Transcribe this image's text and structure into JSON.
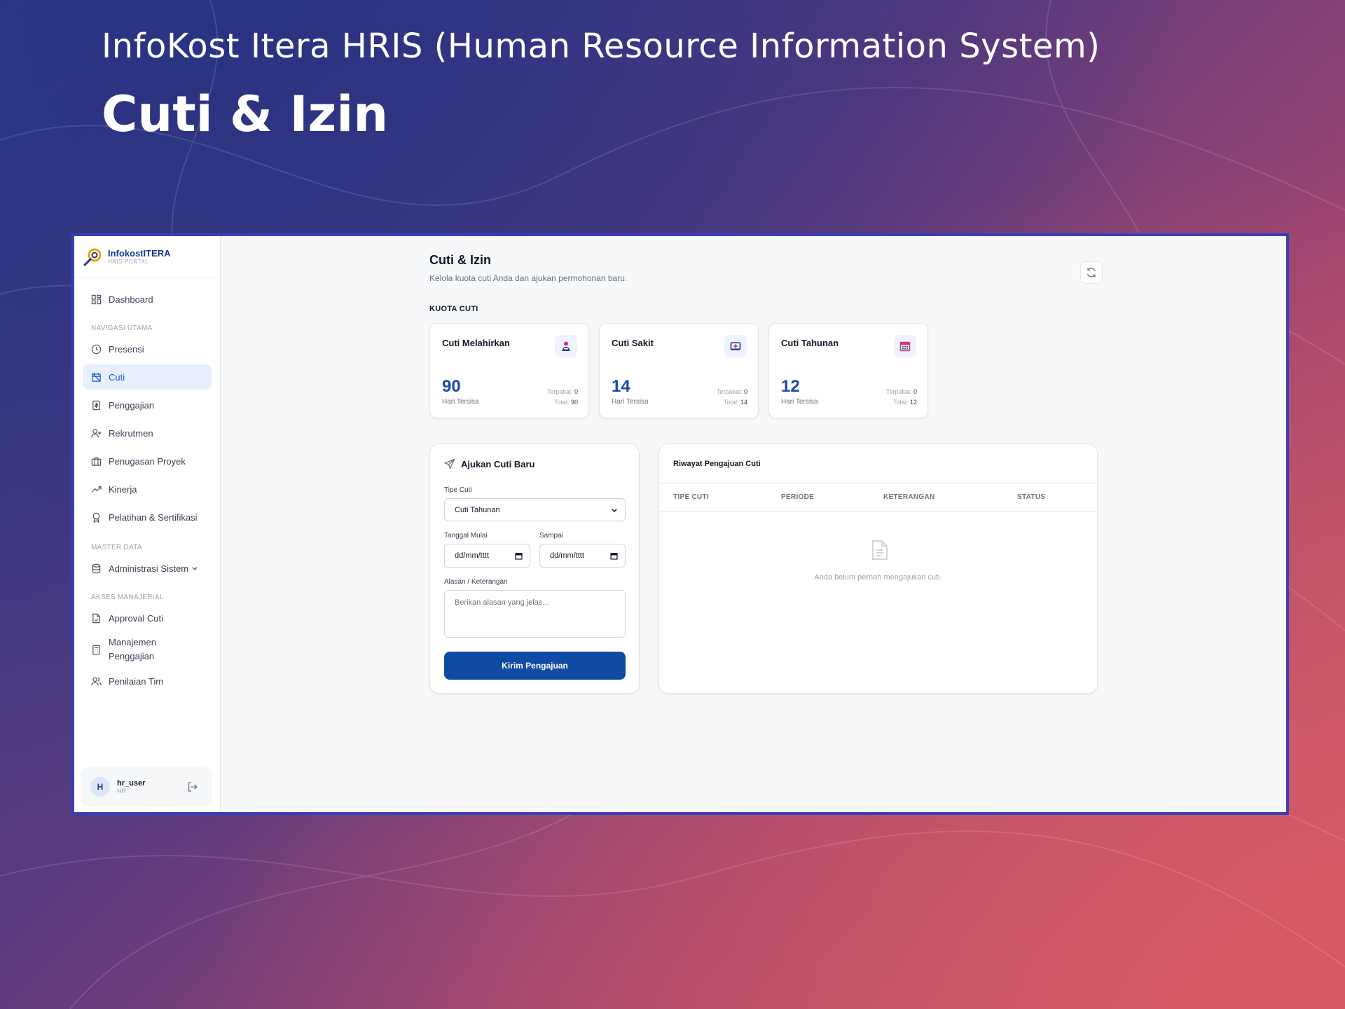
{
  "slide": {
    "subtitle": "InfoKost Itera HRIS (Human Resource Information System)",
    "title": "Cuti & Izin"
  },
  "brand": {
    "name": "InfokostITERA",
    "sub": "HRIS PORTAL"
  },
  "sidebar": {
    "dashboard": "Dashboard",
    "section_main": "NAVIGASI UTAMA",
    "main_items": [
      {
        "label": "Presensi",
        "icon": "clock-icon"
      },
      {
        "label": "Cuti",
        "icon": "calendar-off-icon",
        "active": true
      },
      {
        "label": "Penggajian",
        "icon": "receipt-icon"
      },
      {
        "label": "Rekrutmen",
        "icon": "user-plus-icon"
      },
      {
        "label": "Penugasan Proyek",
        "icon": "briefcase-icon"
      },
      {
        "label": "Kinerja",
        "icon": "trending-up-icon"
      },
      {
        "label": "Pelatihan & Sertifikasi",
        "icon": "award-icon"
      }
    ],
    "section_master": "MASTER DATA",
    "master_items": [
      {
        "label": "Administrasi Sistem",
        "icon": "database-icon"
      }
    ],
    "section_managerial": "AKSES MANAJERIAL",
    "managerial_items": [
      {
        "label": "Approval Cuti",
        "icon": "file-check-icon"
      },
      {
        "label": "Manajemen Penggajian",
        "icon": "calculator-icon"
      },
      {
        "label": "Penilaian Tim",
        "icon": "users-icon"
      }
    ],
    "user": {
      "initial": "H",
      "name": "hr_user",
      "role": "HR"
    }
  },
  "page": {
    "title": "Cuti & Izin",
    "description": "Kelola kuota cuti Anda dan ajukan permohonan baru.",
    "quota_label": "KUOTA CUTI"
  },
  "quota_cards": [
    {
      "title": "Cuti Melahirkan",
      "remaining": "90",
      "remaining_label": "Hari Tersisa",
      "used_label": "Terpakai:",
      "used": "0",
      "total_label": "Total:",
      "total": "90",
      "icon": "maternity-icon",
      "icon_color": "#d6336c"
    },
    {
      "title": "Cuti Sakit",
      "remaining": "14",
      "remaining_label": "Hari Tersisa",
      "used_label": "Terpakai:",
      "used": "0",
      "total_label": "Total:",
      "total": "14",
      "icon": "medical-icon",
      "icon_color": "#1e3a8a"
    },
    {
      "title": "Cuti Tahunan",
      "remaining": "12",
      "remaining_label": "Hari Tersisa",
      "used_label": "Terpakai:",
      "used": "0",
      "total_label": "Total:",
      "total": "12",
      "icon": "calendar-icon",
      "icon_color": "#d6336c"
    }
  ],
  "form": {
    "title": "Ajukan Cuti Baru",
    "type_label": "Tipe Cuti",
    "type_value": "Cuti Tahunan",
    "start_label": "Tanggal Mulai",
    "start_placeholder": "dd/mm/tttt",
    "end_label": "Sampai",
    "end_placeholder": "dd/mm/tttt",
    "reason_label": "Alasan / Keterangan",
    "reason_placeholder": "Berikan alasan yang jelas...",
    "submit": "Kirim Pengajuan"
  },
  "history": {
    "title": "Riwayat Pengajuan Cuti",
    "columns": [
      "TIPE CUTI",
      "PERIODE",
      "KETERANGAN",
      "STATUS"
    ],
    "empty_text": "Anda belum pernah mengajukan cuti."
  },
  "colors": {
    "accent": "#0f4aa3",
    "frame": "#3a3fb8",
    "active_bg": "#e8effc"
  }
}
